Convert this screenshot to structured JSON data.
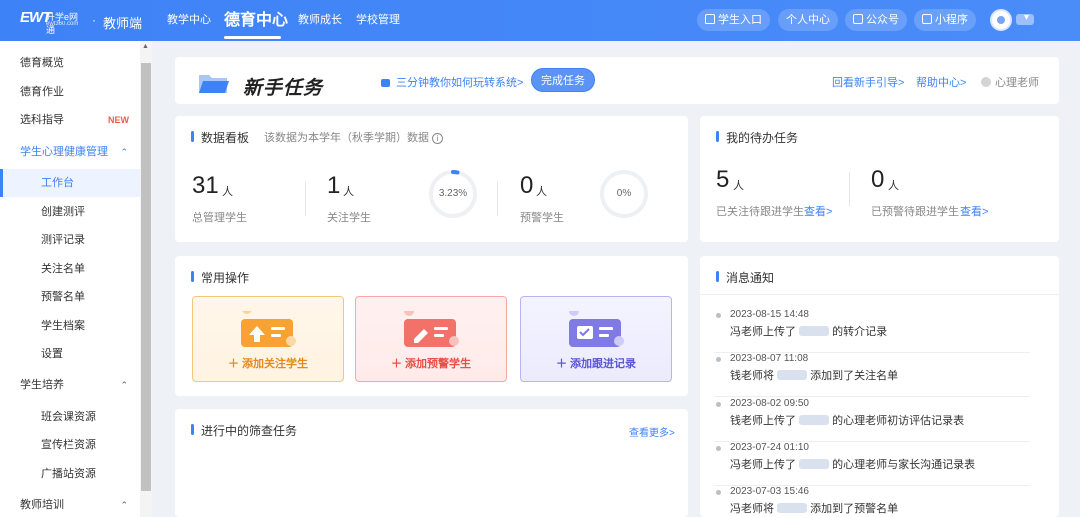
{
  "header": {
    "logo_text": "EWT",
    "logo_cn": "升学e网通",
    "logo_sub": "ewt360.com",
    "role_sep": "·",
    "role": "教师端",
    "nav": [
      {
        "label": "教学中心"
      },
      {
        "label": "德育中心",
        "active": true
      },
      {
        "label": "教师成长"
      },
      {
        "label": "学校管理"
      }
    ],
    "actions": {
      "student_entry": "学生入口",
      "personal_center": "个人中心",
      "official_account": "公众号",
      "mini_program": "小程序"
    }
  },
  "sidebar": {
    "items": [
      {
        "label": "德育概览"
      },
      {
        "label": "德育作业"
      },
      {
        "label": "选科指导",
        "badge": "NEW"
      },
      {
        "label": "学生心理健康管理",
        "arrow": "⌃"
      },
      {
        "label": "工作台"
      },
      {
        "label": "创建测评"
      },
      {
        "label": "测评记录"
      },
      {
        "label": "关注名单"
      },
      {
        "label": "预警名单"
      },
      {
        "label": "学生档案"
      },
      {
        "label": "设置"
      },
      {
        "label": "学生培养",
        "arrow": "⌃"
      },
      {
        "label": "班会课资源"
      },
      {
        "label": "宣传栏资源"
      },
      {
        "label": "广播站资源"
      },
      {
        "label": "教师培训",
        "arrow": "⌃"
      }
    ]
  },
  "banner": {
    "title": "新手任务",
    "video_link": "三分钟教你如何玩转系统>",
    "complete_button": "完成任务",
    "review_link": "回看新手引导>",
    "help_link": "帮助中心>",
    "teacher": "心理老师"
  },
  "dashboard": {
    "title": "数据看板",
    "note": "该数据为本学年（秋季学期）数据",
    "info_icon": "i",
    "unit": "人",
    "total": {
      "value": "31",
      "label": "总管理学生"
    },
    "attention": {
      "value": "1",
      "label": "关注学生",
      "percent_text": "3.23%",
      "percent": 3.23
    },
    "warning": {
      "value": "0",
      "label": "预警学生",
      "percent_text": "0%",
      "percent": 0
    }
  },
  "todo": {
    "title": "我的待办任务",
    "unit": "人",
    "view": "查看>",
    "followed": {
      "value": "5",
      "label": "已关注待跟进学生"
    },
    "warned": {
      "value": "0",
      "label": "已预警待跟进学生"
    }
  },
  "operations": {
    "title": "常用操作",
    "add_attention": "＋ 添加关注学生",
    "add_warning": "＋ 添加预警学生",
    "add_followup": "＋ 添加跟进记录"
  },
  "screening": {
    "title": "进行中的筛查任务",
    "more": "查看更多>"
  },
  "messages": {
    "title": "消息通知",
    "items": [
      {
        "time": "2023-08-15 14:48",
        "pre": "冯老师上传了",
        "post": "的转介记录"
      },
      {
        "time": "2023-08-07 11:08",
        "pre": "钱老师将",
        "post": "添加到了关注名单"
      },
      {
        "time": "2023-08-02 09:50",
        "pre": "钱老师上传了",
        "post": "的心理老师初访评估记录表"
      },
      {
        "time": "2023-07-24 01:10",
        "pre": "冯老师上传了",
        "post": "的心理老师与家长沟通记录表"
      },
      {
        "time": "2023-07-03 15:46",
        "pre": "冯老师将",
        "post": "添加到了预警名单"
      }
    ]
  },
  "colors": {
    "primary": "#3e82f7",
    "orange": "#e58a1a",
    "red": "#ea4f47",
    "purple": "#5b57d6",
    "new_badge": "#f05a4b"
  }
}
